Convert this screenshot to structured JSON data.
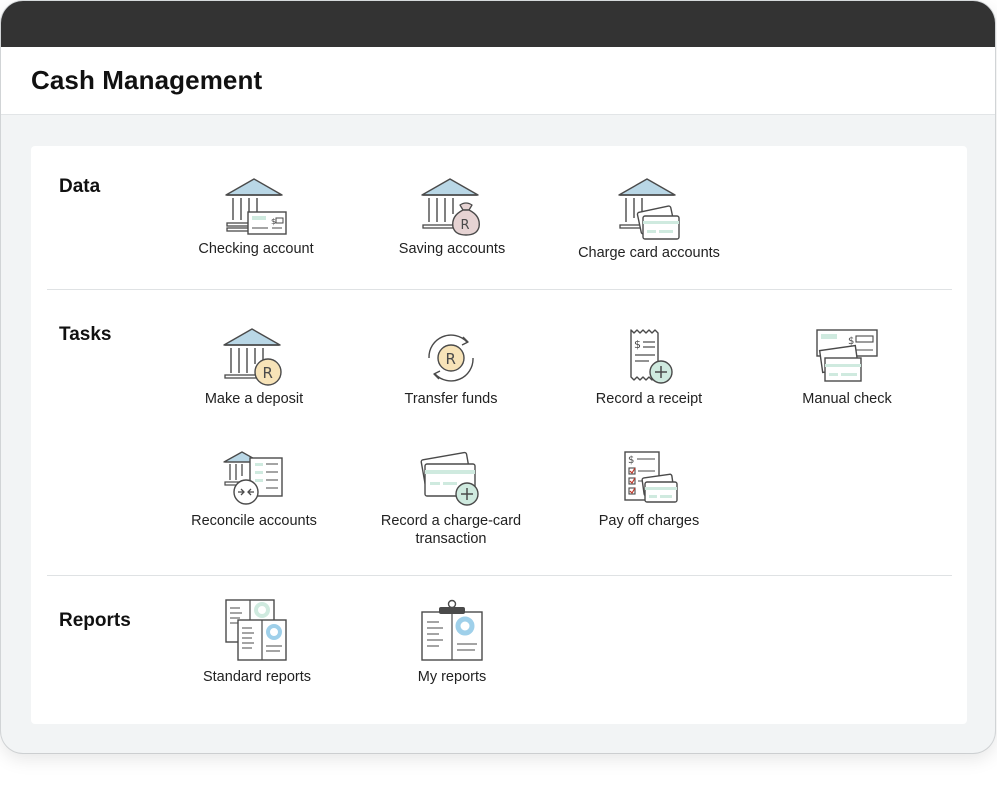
{
  "page": {
    "title": "Cash Management"
  },
  "sections": {
    "data": {
      "title": "Data",
      "items": [
        {
          "label": "Checking account",
          "icon": "bank-check-icon"
        },
        {
          "label": "Saving accounts",
          "icon": "bank-moneybag-icon"
        },
        {
          "label": "Charge card accounts",
          "icon": "bank-cards-icon"
        }
      ]
    },
    "tasks": {
      "title": "Tasks",
      "items": [
        {
          "label": "Make a deposit",
          "icon": "bank-coin-icon"
        },
        {
          "label": "Transfer funds",
          "icon": "coin-cycle-icon"
        },
        {
          "label": "Record a receipt",
          "icon": "receipt-plus-icon"
        },
        {
          "label": "Manual check",
          "icon": "checks-icon"
        },
        {
          "label": "Reconcile accounts",
          "icon": "reconcile-icon"
        },
        {
          "label": "Record a charge-card transaction",
          "icon": "cards-plus-icon"
        },
        {
          "label": "Pay off charges",
          "icon": "checklist-cards-icon"
        }
      ]
    },
    "reports": {
      "title": "Reports",
      "items": [
        {
          "label": "Standard reports",
          "icon": "reports-stack-icon"
        },
        {
          "label": "My reports",
          "icon": "clipboard-report-icon"
        }
      ]
    }
  },
  "colors": {
    "titlebar": "#333333",
    "background": "#f2f4f5",
    "icon_stroke": "#4a4a4a",
    "roof_fill": "#b9d7e6",
    "accent_green": "#cfeadf",
    "coin_fill": "#f7e3b8",
    "donut_blue": "#9fd0ea",
    "moneybag_fill": "#e6d3d3"
  }
}
